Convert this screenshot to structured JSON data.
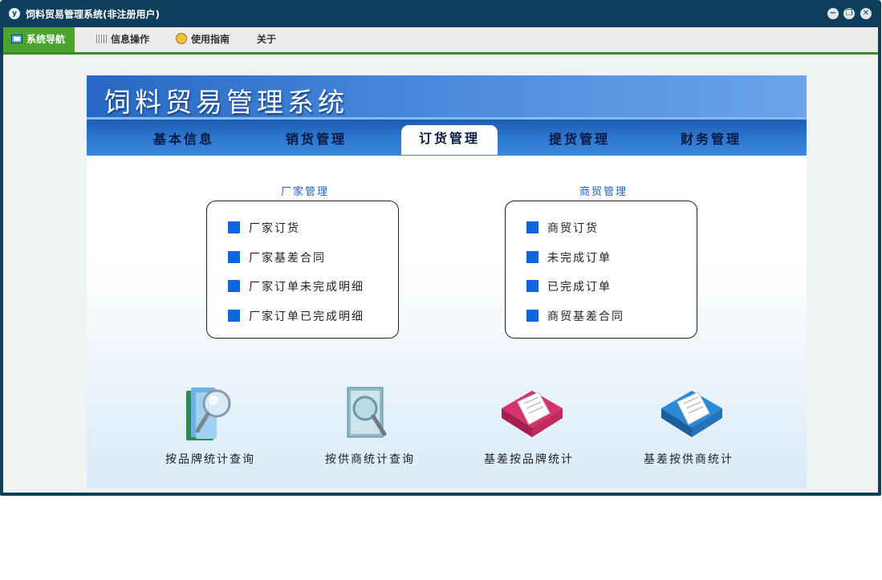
{
  "window": {
    "title": "饲料贸易管理系统(非注册用户)",
    "controls": [
      "minimize-icon",
      "restore-icon",
      "close-icon"
    ]
  },
  "menubar": {
    "items": [
      {
        "label": "系统导航",
        "icon": "monitor-icon",
        "active": true
      },
      {
        "label": "信息操作",
        "icon": "grid-icon",
        "active": false
      },
      {
        "label": "使用指南",
        "icon": "bulb-icon",
        "active": false
      },
      {
        "label": "关于",
        "icon": "",
        "active": false
      }
    ],
    "accent_color": "#4ba330"
  },
  "banner": {
    "title": "饲料贸易管理系统"
  },
  "tabs": [
    {
      "label": "基本信息",
      "active": false
    },
    {
      "label": "销货管理",
      "active": false
    },
    {
      "label": "订货管理",
      "active": true
    },
    {
      "label": "提货管理",
      "active": false
    },
    {
      "label": "财务管理",
      "active": false
    }
  ],
  "sections": [
    {
      "title": "厂家管理",
      "items": [
        "厂家订货",
        "厂家基差合同",
        "厂家订单未完成明细",
        "厂家订单已完成明细"
      ]
    },
    {
      "title": "商贸管理",
      "items": [
        "商贸订货",
        "未完成订单",
        "已完成订单",
        "商贸基差合同"
      ]
    }
  ],
  "tools": [
    {
      "label": "按品牌统计查询",
      "icon": "folder-magnifier-icon"
    },
    {
      "label": "按供商统计查询",
      "icon": "document-search-icon"
    },
    {
      "label": "基差按品牌统计",
      "icon": "red-book-icon"
    },
    {
      "label": "基差按供商统计",
      "icon": "blue-book-icon"
    }
  ],
  "colors": {
    "banner_blue": "#2668c4",
    "bullet_blue": "#1164dd",
    "section_title": "#1e63c4"
  }
}
